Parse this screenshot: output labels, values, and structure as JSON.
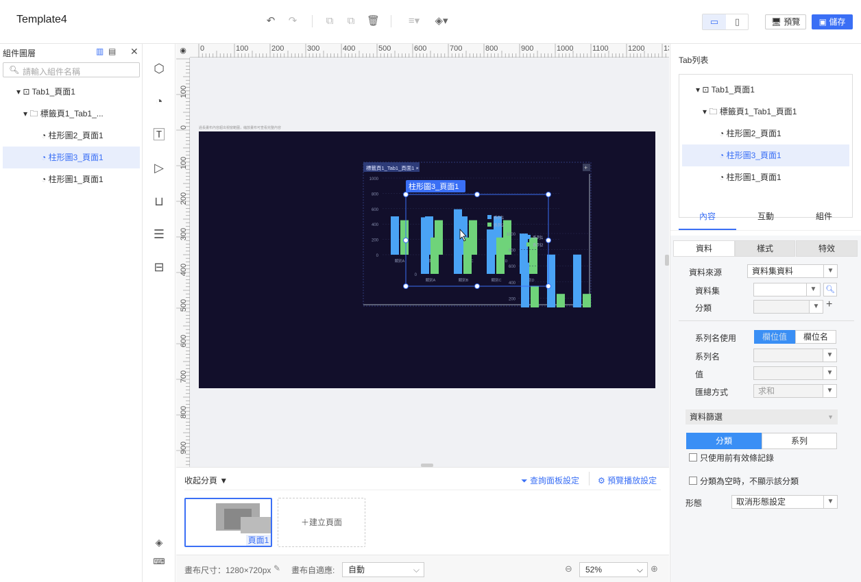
{
  "app": {
    "title": "Template4"
  },
  "toolbar": {
    "preview_label": "預覽",
    "save_label": "儲存"
  },
  "layers": {
    "header": "組件圖層",
    "search_placeholder": "請輸入組件名稱",
    "items": [
      {
        "label": "Tab1_頁面1"
      },
      {
        "label": "標籤頁1_Tab1_..."
      },
      {
        "label": "柱形圖2_頁面1"
      },
      {
        "label": "柱形圖3_頁面1"
      },
      {
        "label": "柱形圖1_頁面1"
      }
    ]
  },
  "canvas": {
    "ruler_top": [
      "0",
      "100",
      "200",
      "300",
      "400",
      "500",
      "600",
      "700",
      "800",
      "900",
      "1000",
      "1100",
      "1200",
      "13"
    ],
    "ruler_left": [
      "100",
      "0",
      "100",
      "200",
      "300",
      "400",
      "500",
      "600",
      "700",
      "800",
      "900"
    ],
    "hint": "過長畫布內容超出視窗範圍，縮放畫布可查看完整內容",
    "tab_label": "標籤頁1_Tab1_頁面1 ×",
    "selected_label": "柱形圖3_頁面1",
    "legend": [
      "系列1",
      "系列2"
    ],
    "axis_a": [
      "1000",
      "800",
      "600",
      "400",
      "200",
      "0"
    ],
    "axis_b": [
      "1000",
      "800",
      "600",
      "400",
      "200",
      "0"
    ],
    "categories": [
      "類別A",
      "類別B",
      "類別C",
      "類別D"
    ]
  },
  "chart_data": [
    {
      "type": "bar",
      "categories": [
        "類別A",
        "類別B",
        "類別C",
        "類別D"
      ],
      "series": [
        {
          "name": "系列1",
          "values": [
            500,
            500,
            500,
            500
          ]
        },
        {
          "name": "系列2",
          "values": [
            450,
            450,
            450,
            450
          ]
        }
      ],
      "ylim": [
        0,
        1000
      ]
    },
    {
      "type": "bar",
      "categories": [
        "類別A",
        "類別B",
        "類別C",
        "類別D"
      ],
      "series": [
        {
          "name": "系列1",
          "values": [
            700,
            800,
            550,
            500
          ]
        },
        {
          "name": "系列2",
          "values": [
            450,
            450,
            450,
            450
          ]
        }
      ],
      "ylim": [
        0,
        1000
      ]
    },
    {
      "type": "bar",
      "categories": [
        "類別A",
        "類別B",
        "類別C",
        "類別D"
      ],
      "series": [
        {
          "name": "系列1",
          "values": [
            300,
            400,
            400,
            350
          ]
        },
        {
          "name": "系列2",
          "values": [
            200,
            100,
            100,
            200
          ]
        }
      ],
      "ylim": [
        0,
        1000
      ]
    }
  ],
  "pages": {
    "collapse_label": "收起分頁",
    "query_panel": "查詢面板設定",
    "preview_settings": "預覽播放設定",
    "page1_label": "頁面1",
    "new_page": "建立頁面"
  },
  "status": {
    "canvas_size": "畫布尺寸：1280×720px",
    "adapt_label": "畫布自適應:",
    "adapt_value": "自動",
    "zoom": "52%"
  },
  "right": {
    "tab_list_title": "Tab列表",
    "tree": [
      {
        "label": "Tab1_頁面1"
      },
      {
        "label": "標籤頁1_Tab1_頁面1"
      },
      {
        "label": "柱形圖2_頁面1"
      },
      {
        "label": "柱形圖3_頁面1"
      },
      {
        "label": "柱形圖1_頁面1"
      }
    ],
    "main_tabs": [
      "內容",
      "互動",
      "組件"
    ],
    "sub_tabs": [
      "資料",
      "樣式",
      "特效"
    ],
    "data_source_label": "資料來源",
    "data_source_value": "資料集資料",
    "dataset_label": "資料集",
    "category_label": "分類",
    "series_name_use_label": "系列名使用",
    "series_toggle": [
      "欄位值",
      "欄位名"
    ],
    "series_name_label": "系列名",
    "value_label": "值",
    "agg_label": "匯總方式",
    "agg_value": "求和",
    "filter_label": "資料篩選",
    "filter_tabs": [
      "分類",
      "系列"
    ],
    "check1": "只使用前有效條記錄",
    "check2": "分類為空時，不顯示該分類",
    "shape_label": "形態",
    "shape_value": "取消形態設定"
  }
}
